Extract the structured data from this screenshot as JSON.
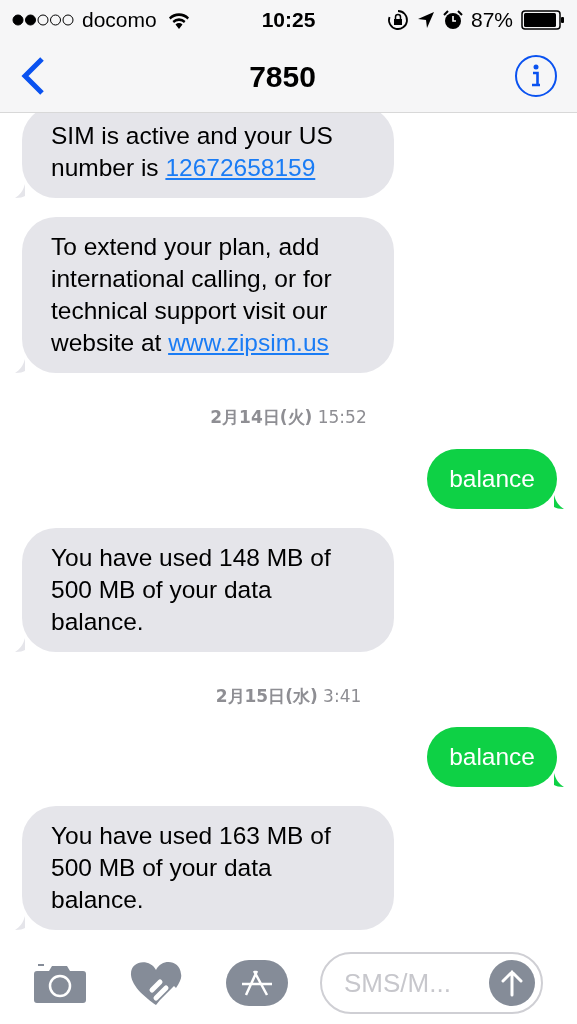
{
  "status_bar": {
    "carrier": "docomo",
    "time": "10:25",
    "battery": "87%"
  },
  "nav": {
    "title": "7850"
  },
  "messages": [
    {
      "kind": "incoming",
      "parts": [
        {
          "text": "SIM is active and your US number is "
        },
        {
          "text": "12672658159",
          "link": true
        }
      ]
    },
    {
      "kind": "incoming",
      "parts": [
        {
          "text": "To extend your plan, add international calling, or for technical support visit our website at "
        },
        {
          "text": "www.zipsim.us",
          "link": true
        }
      ]
    },
    {
      "kind": "timestamp",
      "text": "**2月14日(火)** 15:52"
    },
    {
      "kind": "outgoing",
      "parts": [
        {
          "text": "balance"
        }
      ]
    },
    {
      "kind": "incoming",
      "parts": [
        {
          "text": "You have used 148 MB of 500 MB of your data balance."
        }
      ]
    },
    {
      "kind": "timestamp",
      "text": "**2月15日(水)** 3:41"
    },
    {
      "kind": "outgoing",
      "parts": [
        {
          "text": "balance"
        }
      ]
    },
    {
      "kind": "incoming",
      "parts": [
        {
          "text": "You have used 163 MB of 500 MB of your data balance."
        }
      ]
    }
  ],
  "composer": {
    "placeholder": "SMS/M..."
  }
}
